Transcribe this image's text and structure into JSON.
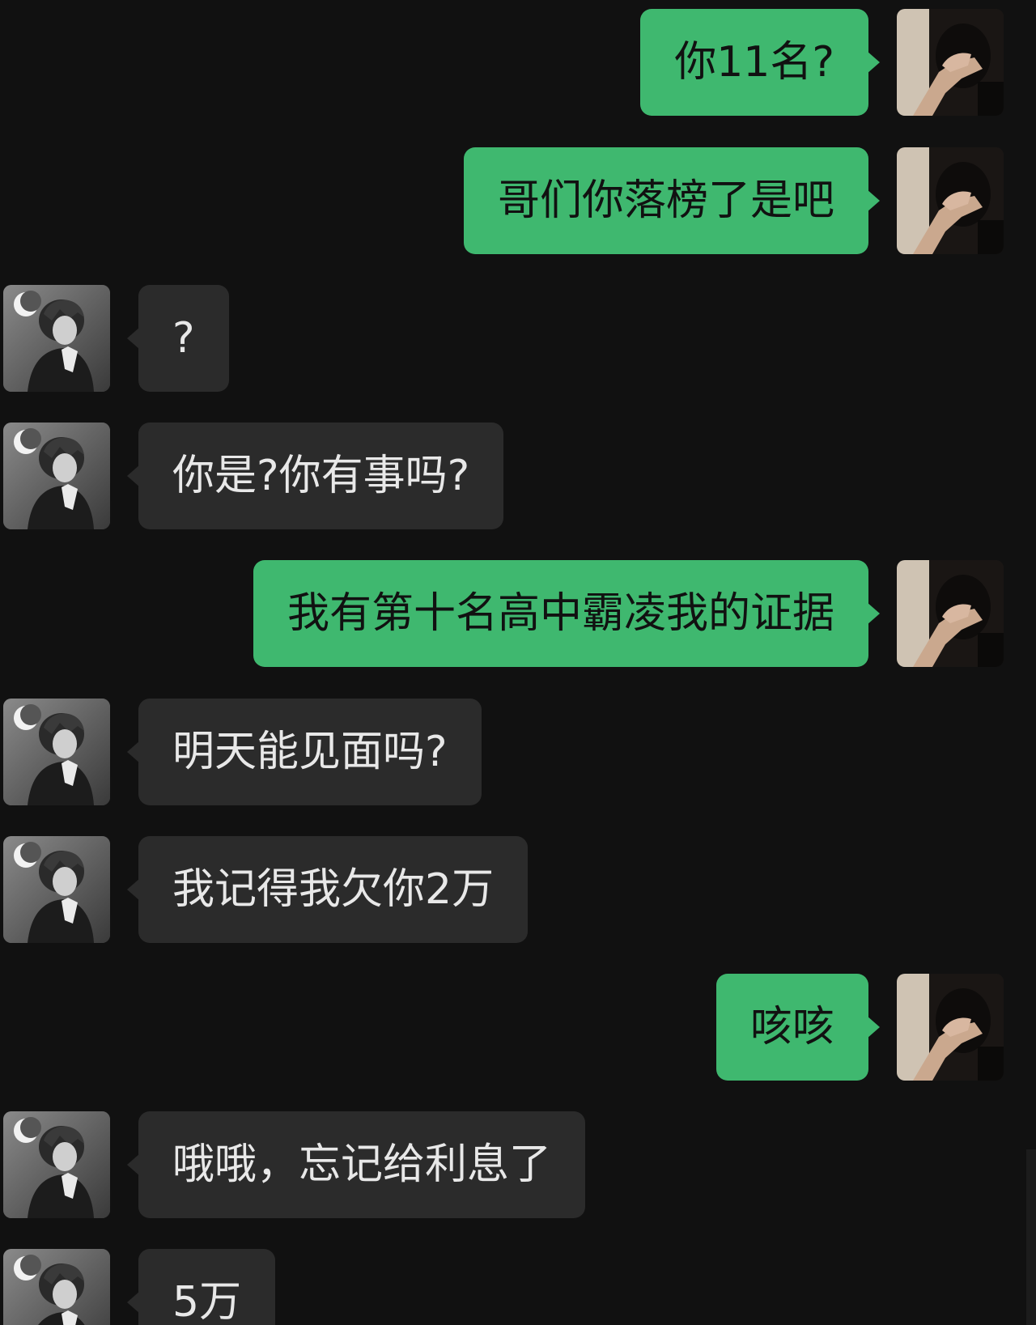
{
  "colors": {
    "background": "#111111",
    "self_bubble": "#3fb86f",
    "other_bubble": "#2b2b2b"
  },
  "avatars": {
    "self": "self-photo-avatar",
    "other": "anime-boy-moon-avatar"
  },
  "messages": [
    {
      "sender": "self",
      "text": "你11名?"
    },
    {
      "sender": "self",
      "text": "哥们你落榜了是吧"
    },
    {
      "sender": "other",
      "text": "?"
    },
    {
      "sender": "other",
      "text": "你是?你有事吗?"
    },
    {
      "sender": "self",
      "text": "我有第十名高中霸凌我的证据"
    },
    {
      "sender": "other",
      "text": "明天能见面吗?"
    },
    {
      "sender": "other",
      "text": "我记得我欠你2万"
    },
    {
      "sender": "self",
      "text": "咳咳"
    },
    {
      "sender": "other",
      "text": "哦哦，忘记给利息了"
    },
    {
      "sender": "other",
      "text": "5万"
    }
  ]
}
